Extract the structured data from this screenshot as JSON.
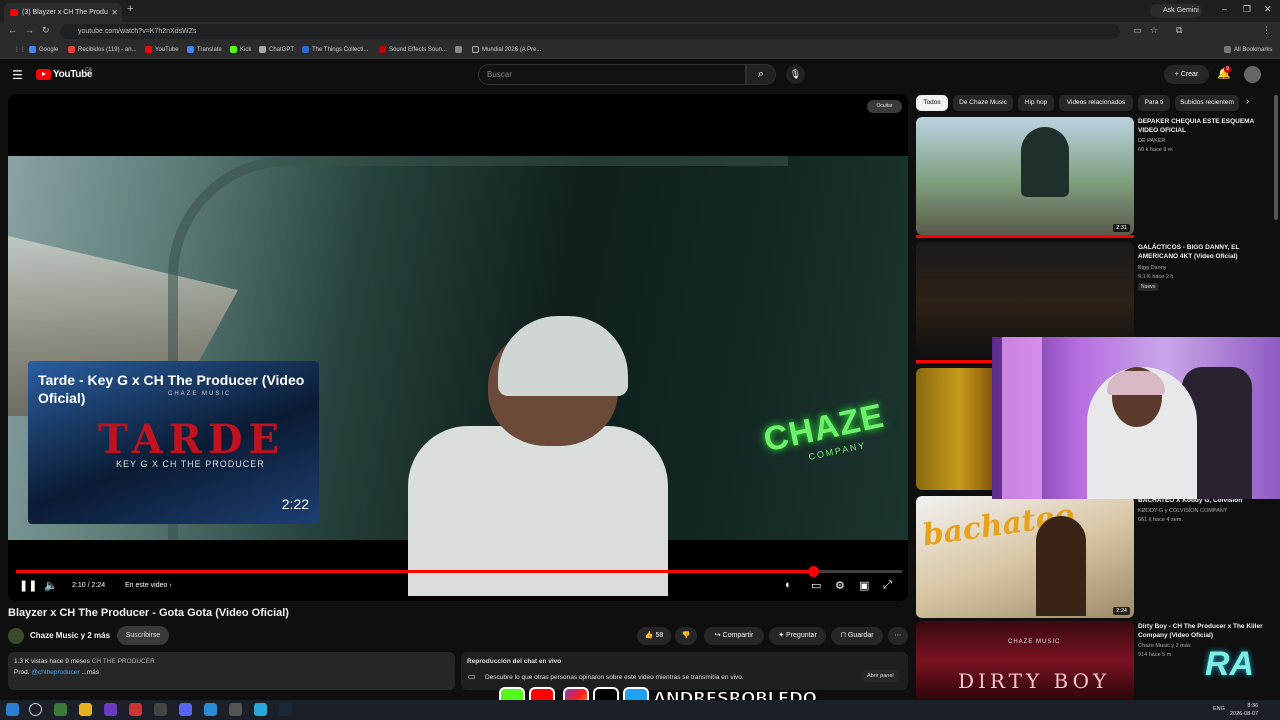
{
  "browser": {
    "tab_title": "(3) Blayzer x CH The Produ",
    "url": "youtube.com/watch?v=K7h2nXdsWZs",
    "gemini": "Ask Gemini",
    "all_bookmarks": "All Bookmarks",
    "bookmarks": [
      {
        "label": "Google",
        "color": "#4285f4"
      },
      {
        "label": "Recibidos (119) - an...",
        "color": "#ea4335"
      },
      {
        "label": "YouTube",
        "color": "#ff0000"
      },
      {
        "label": "Translate",
        "color": "#4285f4"
      },
      {
        "label": "Kick",
        "color": "#53fc18"
      },
      {
        "label": "ChatGPT",
        "color": "#aaaaaa"
      },
      {
        "label": "The Things Collecti...",
        "color": "#2a6ad2"
      },
      {
        "label": "Sound Effects Soun...",
        "color": "#c00000"
      },
      {
        "label": "",
        "color": "#888888"
      },
      {
        "label": "Mundial 2026 (A Pre...",
        "color": "#333333"
      }
    ]
  },
  "youtube": {
    "logo": "YouTube",
    "country": "CA",
    "search_placeholder": "Buscar",
    "create": "Crear",
    "notif_count": "9"
  },
  "player": {
    "hide_label": "Ocultar",
    "endcard_title": "Tarde - Key G x CH The Producer (Video Oficial)",
    "endcard_art_title": "TARDE",
    "endcard_art_sub": "KEY G X CH THE PRODUCER",
    "endcard_art_brand": "CHAZE MUSIC",
    "endcard_duration": "2:22",
    "watermark_line1": "CHAZE",
    "watermark_line2": "COMPANY",
    "time": "2:10 / 2:24",
    "chapter": "En este video",
    "progress": 0.9
  },
  "video": {
    "title": "Blayzer x CH The Producer - Gota Gota (Video Oficial)",
    "channel": "Chaze Music y 2 más",
    "subscribe": "Suscribirse",
    "likes": "58",
    "share": "Compartir",
    "ask": "Preguntar",
    "save": "Guardar",
    "views": "1.3 K vistas  hace 9 meses",
    "tag": "CH THE PRODUCER",
    "desc_prefix": "Prod.",
    "desc_handle": "@chtheproducer",
    "desc_more": "...más",
    "chat_title": "Reproducción del chat en vivo",
    "chat_text": "Descubre lo que otras personas opinaron sobre este video mientras se transmitía en vivo.",
    "chat_open": "Abrir panel"
  },
  "chips": [
    "Todos",
    "De Chaze Music",
    "Hip hop",
    "Videos relacionados",
    "Para ti",
    "Subidos recientem"
  ],
  "recs": [
    {
      "title": "DEPAKER CHEQUIA ESTE ESQUEMA VIDEO OFICIAL",
      "channel": "DE PAKER",
      "meta": "60 k  hace 9 m",
      "dur": "2:31",
      "badge": ""
    },
    {
      "title": "GALÁCTICOS - BIGG DANNY, EL AMERICANO 4KT (Video Oficial)",
      "channel": "Bigg Danny",
      "meta": "9.1 K  hace 2 h",
      "dur": "",
      "badge": "Nuevo"
    },
    {
      "title": "",
      "channel": "",
      "meta": "",
      "dur": "",
      "badge": ""
    },
    {
      "title": "BACHATEO X Koddy G, Colvision",
      "channel": "KØDDY-G y COLVISION COMPANY",
      "meta": "661 k  hace 4 sem.",
      "dur": "2:24",
      "badge": ""
    },
    {
      "title": "Dirty Boy  - CH The Producer x The Killer Company (Video Oficial)",
      "channel": "Chaze Music y 2 más",
      "meta": "914  hace 5 m",
      "dur": "",
      "badge": ""
    }
  ],
  "rec_art": {
    "bachateo": "bachateo",
    "dirty": "DIRTY BOY",
    "dirty_brand": "CHAZE MUSIC"
  },
  "overlay": {
    "handle": "ANDRESROBLEDO"
  },
  "taskbar": {
    "lang": "ENG",
    "time": "8:36",
    "date": "2026-08-07"
  },
  "colors": {
    "accent": "#ff0000",
    "bg": "#0f0f0f",
    "watermark": "#6ef26e"
  }
}
